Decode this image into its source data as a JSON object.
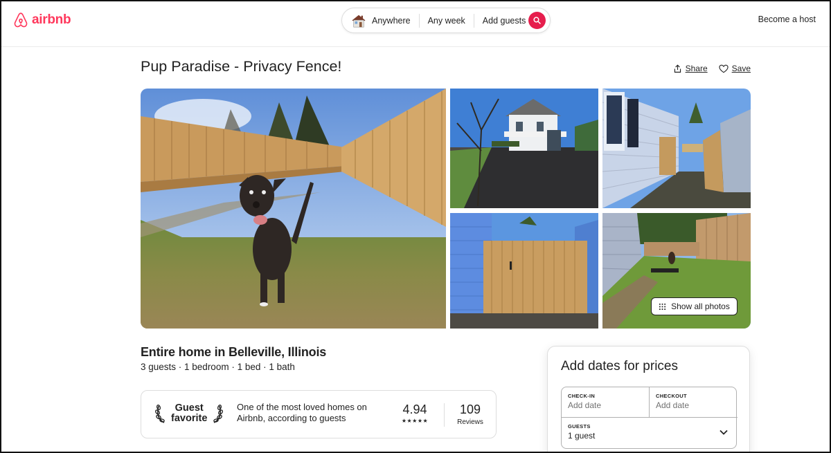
{
  "header": {
    "logo_text": "airbnb",
    "search": {
      "where": "Anywhere",
      "when": "Any week",
      "who": "Add guests"
    },
    "become_host": "Become a host"
  },
  "listing": {
    "title": "Pup Paradise - Privacy Fence!",
    "share_label": "Share",
    "save_label": "Save",
    "show_all_photos": "Show all photos",
    "type_location": "Entire home in Belleville, Illinois",
    "details": "3 guests · 1 bedroom · 1 bed · 1 bath"
  },
  "guest_favorite": {
    "badge_line1": "Guest",
    "badge_line2": "favorite",
    "description": "One of the most loved homes on Airbnb, according to guests",
    "rating": "4.94",
    "stars": "★★★★★",
    "reviews_count": "109",
    "reviews_label": "Reviews"
  },
  "booking": {
    "title": "Add dates for prices",
    "checkin_label": "CHECK-IN",
    "checkin_value": "Add date",
    "checkout_label": "CHECKOUT",
    "checkout_value": "Add date",
    "guests_label": "GUESTS",
    "guests_value": "1 guest"
  },
  "colors": {
    "brand": "#FF385C",
    "search_button": "#E61E4D",
    "text": "#222222",
    "muted": "#717171",
    "border": "#DDDDDD"
  },
  "icons": [
    "airbnb-logo-icon",
    "house-icon",
    "search-icon",
    "share-icon",
    "heart-icon",
    "grid-icon",
    "laurel-left-icon",
    "laurel-right-icon",
    "chevron-down-icon"
  ]
}
